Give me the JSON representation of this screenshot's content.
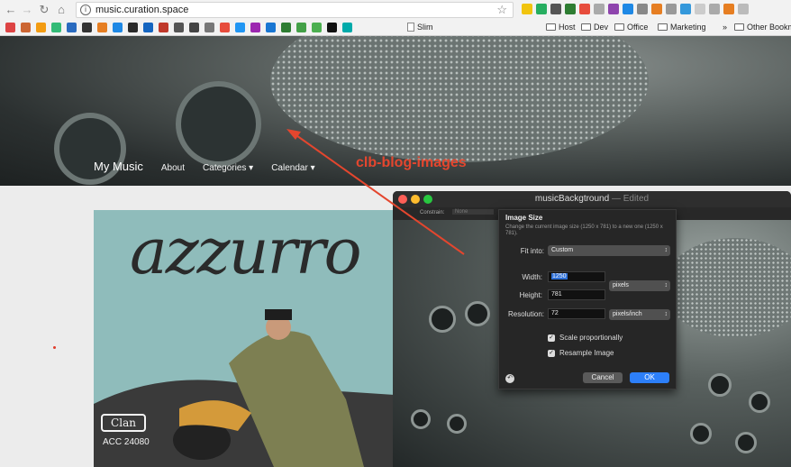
{
  "browser": {
    "url": "music.curation.space",
    "bookmarks": [
      "Slim",
      "Host",
      "Dev",
      "Office",
      "Marketing",
      "Other Bookm"
    ],
    "bookmark_overflow": "»",
    "bookmark_icon_colors": [
      "#d44",
      "#c63",
      "#f39c12",
      "#3b7",
      "#2a6bbf",
      "#333",
      "#e67e22",
      "#1e88e5",
      "#2a2a2a",
      "#1565c0",
      "#c0392b",
      "#555",
      "#444",
      "#777",
      "#e74c3c",
      "#2196f3",
      "#9c27b0",
      "#1976d2",
      "#2e7d32",
      "#43a047",
      "#4caf50",
      "#111",
      "#0aa"
    ],
    "extension_colors": [
      "#f1c40f",
      "#27ae60",
      "#555",
      "#2e7d32",
      "#e74c3c",
      "#aaa",
      "#8e44ad",
      "#1e88e5",
      "#888",
      "#e67e22",
      "#999",
      "#3498db",
      "#ccc",
      "#aaa",
      "#e67e22",
      "#bbb"
    ]
  },
  "site": {
    "brand": "My Music",
    "nav": [
      "About",
      "Categories ▾",
      "Calendar ▾"
    ]
  },
  "annotation": "clb-blog-images",
  "album": {
    "title": "azzurro",
    "label_logo": "Clan",
    "catalog": "ACC 24080"
  },
  "preview_window": {
    "title": "musicBackgtround",
    "title_suffix": "— Edited",
    "constrain_label": "Constrain:",
    "constrain_value": "None"
  },
  "image_size": {
    "title": "Image Size",
    "description": "Change the current image size (1250 x 781) to a new one (1250 x 781).",
    "fit_into_label": "Fit into:",
    "fit_into_value": "Custom",
    "width_label": "Width:",
    "width_value": "1250",
    "height_label": "Height:",
    "height_value": "781",
    "unit_value": "pixels",
    "resolution_label": "Resolution:",
    "resolution_value": "72",
    "resolution_unit": "pixels/inch",
    "scale_label": "Scale proportionally",
    "resample_label": "Resample Image",
    "cancel_label": "Cancel",
    "ok_label": "OK"
  }
}
